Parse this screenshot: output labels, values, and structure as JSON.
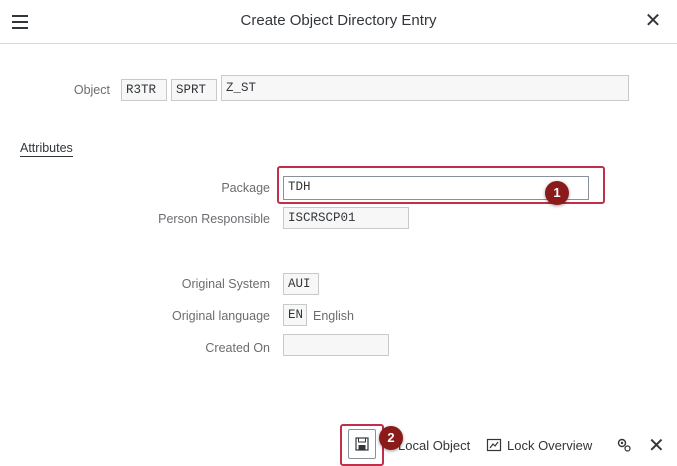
{
  "window": {
    "title": "Create Object Directory Entry"
  },
  "object": {
    "label": "Object",
    "pgmid": "R3TR",
    "type": "SPRT",
    "name": "Z_ST"
  },
  "attributes": {
    "section_title": "Attributes",
    "package_label": "Package",
    "package_value": "TDH",
    "person_label": "Person Responsible",
    "person_value": "ISCRSCP01",
    "orig_system_label": "Original System",
    "orig_system_value": "AUI",
    "orig_language_label": "Original language",
    "orig_language_code": "EN",
    "orig_language_text": "English",
    "created_on_label": "Created On",
    "created_on_value": ""
  },
  "markers": {
    "m1": "1",
    "m2": "2"
  },
  "footer": {
    "local_object": "Local Object",
    "lock_overview": "Lock Overview"
  },
  "colors": {
    "highlight": "#c0304a",
    "marker": "#8b1a1a"
  }
}
